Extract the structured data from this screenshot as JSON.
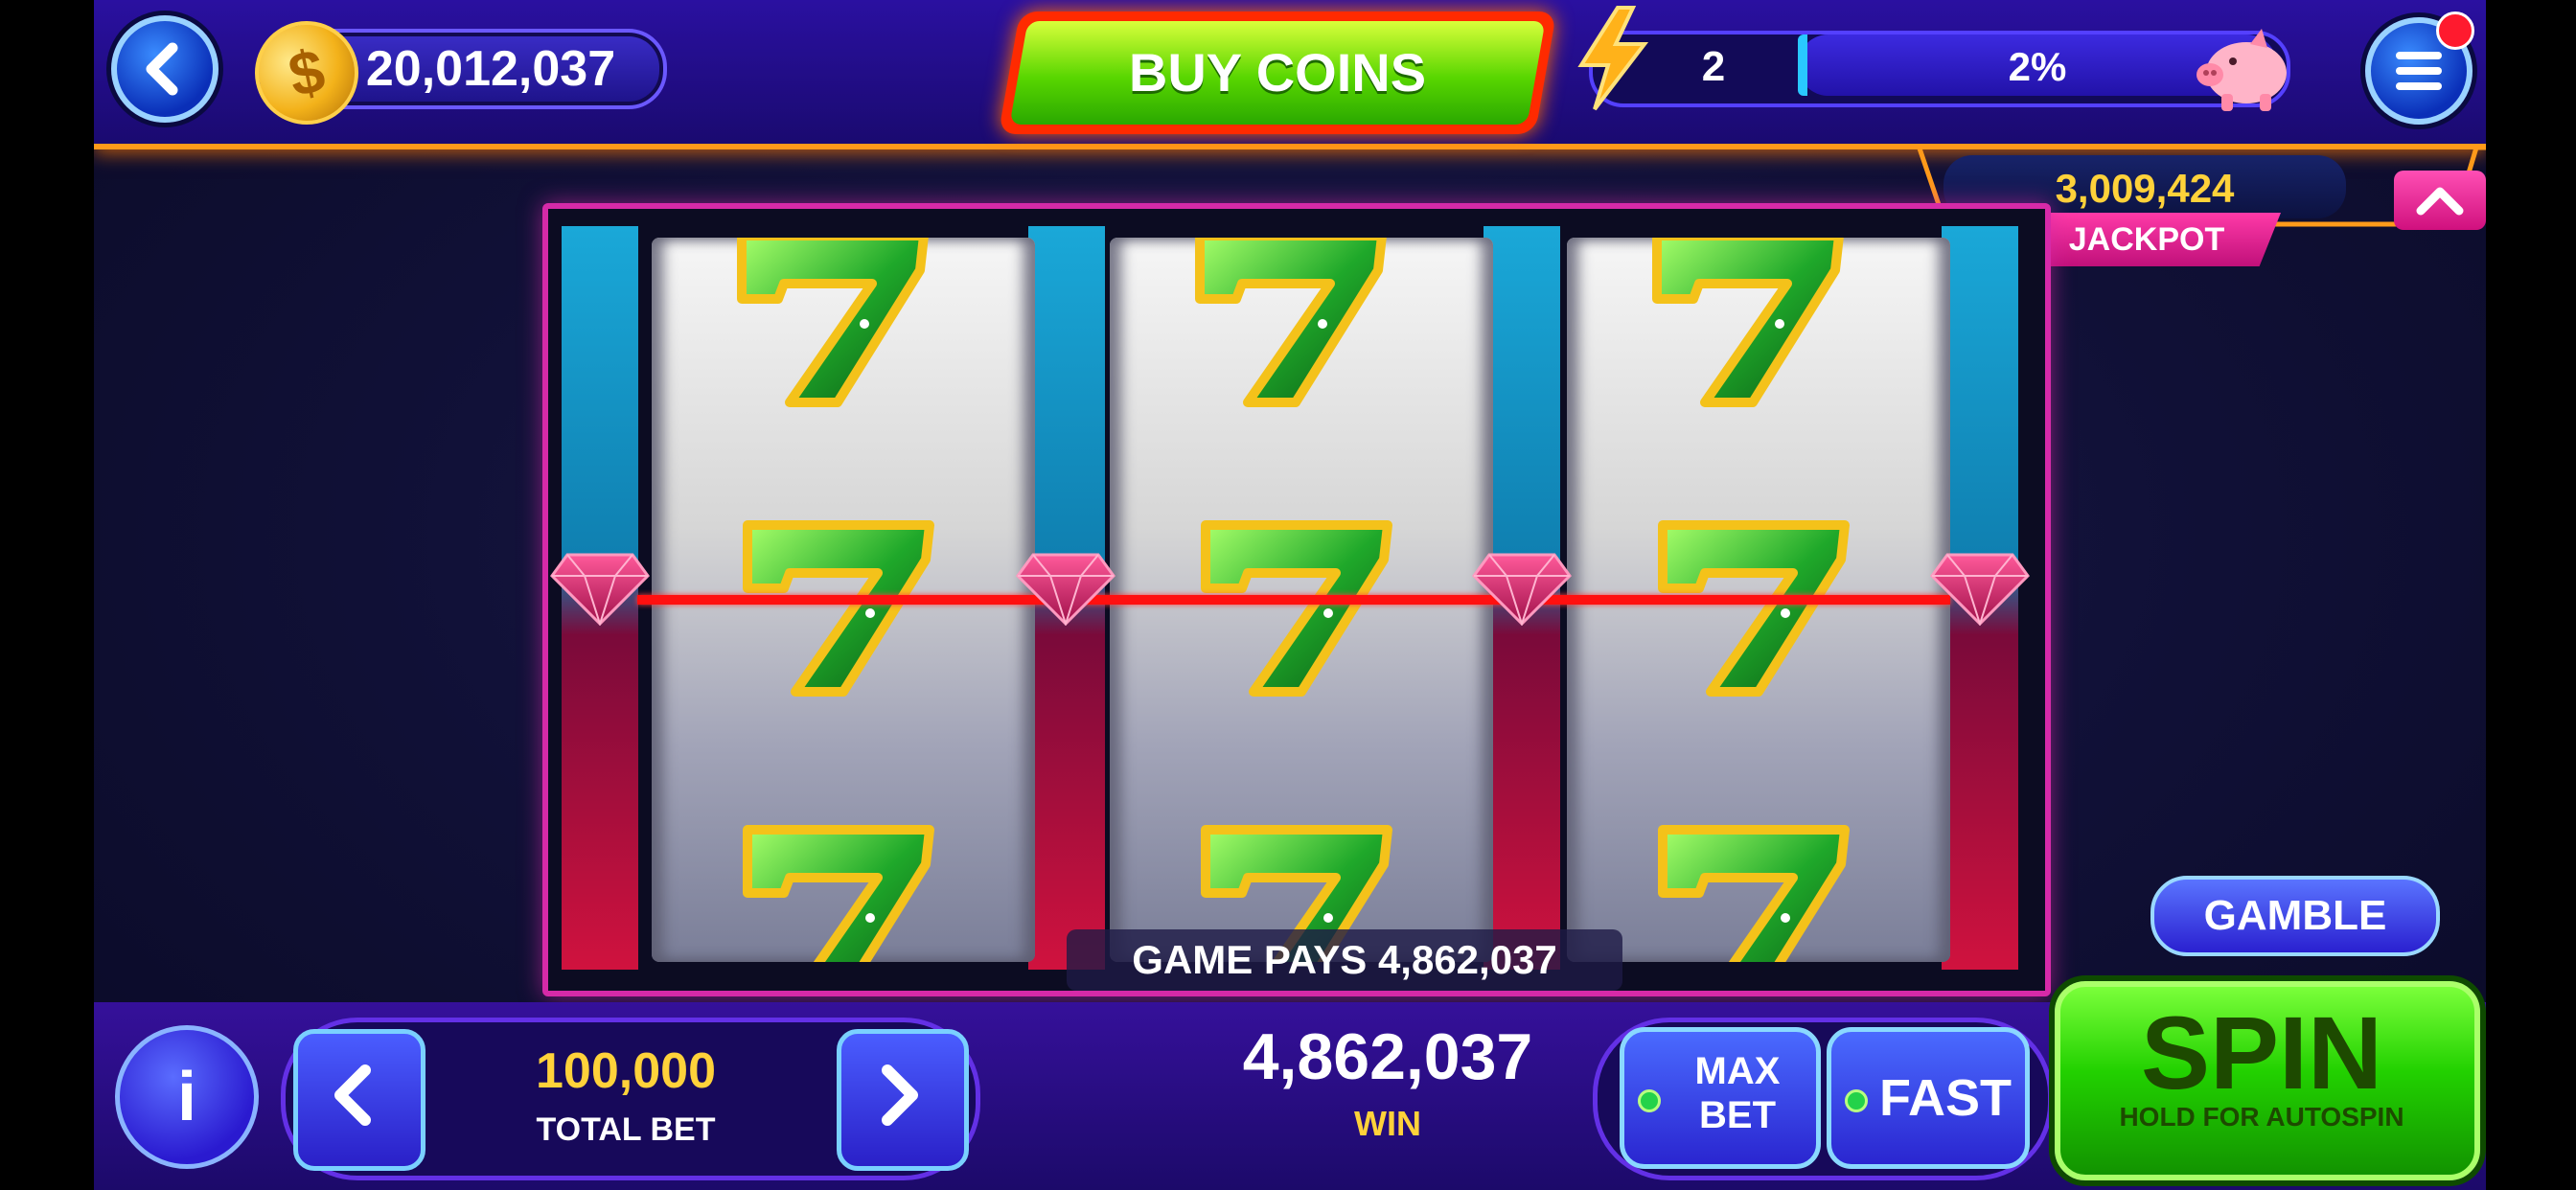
{
  "header": {
    "coins": "20,012,037",
    "buy_coins_label": "BUY COINS",
    "level": "2",
    "xp_percent": "2%",
    "xp_fraction": 0.02
  },
  "jackpot": {
    "value": "3,009,424",
    "label": "JACKPOT"
  },
  "reels": {
    "symbol": "green-seven",
    "columns": 3,
    "rows": 3
  },
  "game_pays": "GAME PAYS 4,862,037",
  "gamble_label": "GAMBLE",
  "bottom": {
    "info_label": "i",
    "total_bet": "100,000",
    "total_bet_label": "TOTAL BET",
    "win_value": "4,862,037",
    "win_label": "WIN",
    "max_bet_line1": "MAX",
    "max_bet_line2": "BET",
    "fast_label": "FAST",
    "spin_label": "SPIN",
    "spin_sub": "HOLD FOR AUTOSPIN"
  },
  "colors": {
    "accent_orange": "#ff9a1a",
    "spin_green": "#22d100",
    "jackpot_gold": "#ffd23a",
    "payline_red": "#ff1010"
  }
}
